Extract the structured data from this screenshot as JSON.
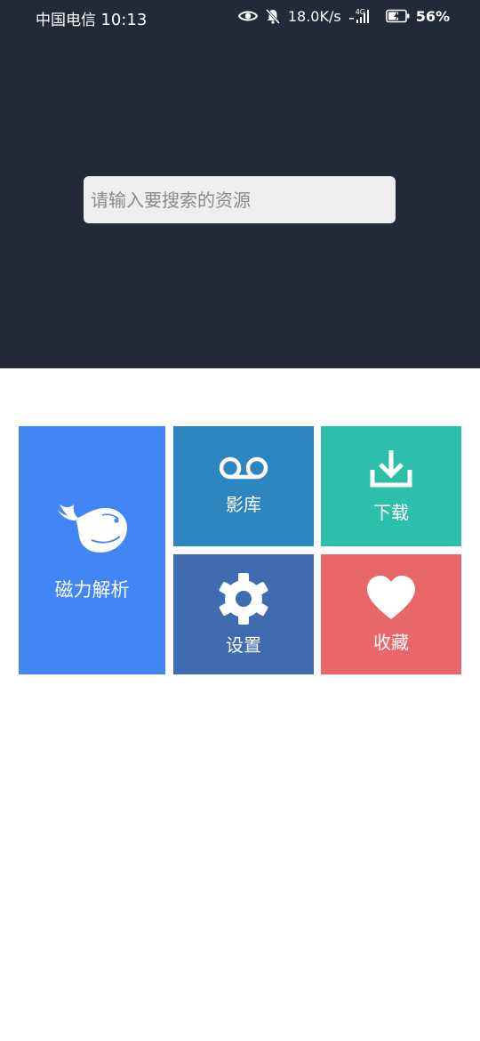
{
  "status_bar": {
    "carrier": "中国电信",
    "time": "10:13",
    "net_speed": "18.0K/s",
    "network_type": "4G",
    "battery_percent": "56%"
  },
  "search": {
    "placeholder": "请输入要搜索的资源",
    "value": ""
  },
  "tiles": {
    "magnet": {
      "label": "磁力解析",
      "icon": "whale-icon",
      "color": "#4285f4"
    },
    "movies": {
      "label": "影库",
      "icon": "voicemail-icon",
      "color": "#2e86c1"
    },
    "download": {
      "label": "下载",
      "icon": "download-icon",
      "color": "#2ebfac"
    },
    "settings": {
      "label": "设置",
      "icon": "gear-icon",
      "color": "#3f6bb0"
    },
    "favorites": {
      "label": "收藏",
      "icon": "heart-icon",
      "color": "#e8676b"
    }
  },
  "colors": {
    "header_bg": "#232a37",
    "search_bg": "#eeeeee",
    "page_bg": "#ffffff"
  }
}
